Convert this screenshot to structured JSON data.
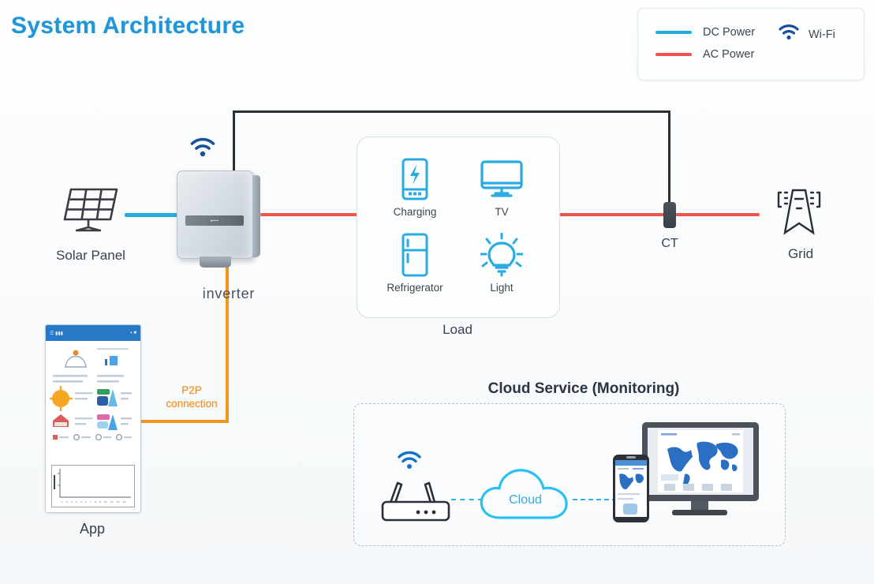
{
  "page": {
    "title": "System Architecture",
    "background_color": "#fafbfc",
    "title_color": "#2196d6"
  },
  "legend": {
    "items": [
      {
        "label": "DC Power",
        "type": "line",
        "color": "#24a9e0",
        "icon": "line-swatch"
      },
      {
        "label": "AC Power",
        "type": "line",
        "color": "#ef5350",
        "icon": "line-swatch"
      },
      {
        "label": "Wi-Fi",
        "type": "icon",
        "color": "#1a4f9c",
        "icon": "wifi-icon"
      }
    ]
  },
  "nodes": {
    "solar_panel": {
      "label": "Solar Panel",
      "icon": "solar-panel-icon"
    },
    "inverter": {
      "label": "inverter",
      "icon": "inverter-icon",
      "wifi_icon": "wifi-icon"
    },
    "ct": {
      "label": "CT",
      "icon": "ct-sensor-icon"
    },
    "grid": {
      "label": "Grid",
      "icon": "transmission-tower-icon"
    },
    "app": {
      "label": "App",
      "icon": "phone-app-icon"
    },
    "load": {
      "label": "Load"
    }
  },
  "load": {
    "label": "Load",
    "items": [
      {
        "label": "Charging",
        "icon": "phone-charging-icon",
        "color": "#29abe2"
      },
      {
        "label": "TV",
        "icon": "tv-icon",
        "color": "#29abe2"
      },
      {
        "label": "Refrigerator",
        "icon": "refrigerator-icon",
        "color": "#29abe2"
      },
      {
        "label": "Light",
        "icon": "light-bulb-icon",
        "color": "#29abe2"
      }
    ]
  },
  "connections": {
    "p2p": {
      "label_line1": "P2P",
      "label_line2": "connection",
      "color": "#f08c1e"
    },
    "dc_color": "#24a9e0",
    "ac_color": "#ef5350",
    "signal_color": "#2b2f3a"
  },
  "cloud_service": {
    "title": "Cloud Service (Monitoring)",
    "cloud_label": "Cloud",
    "router": {
      "icon": "router-icon",
      "wifi_icon": "wifi-icon"
    },
    "monitor": {
      "icon": "monitor-dashboard-icon"
    },
    "phone": {
      "icon": "smartphone-dashboard-icon"
    },
    "link_color": "#2bb3e8"
  },
  "app_screen": {
    "status_left": "",
    "status_right": ""
  }
}
